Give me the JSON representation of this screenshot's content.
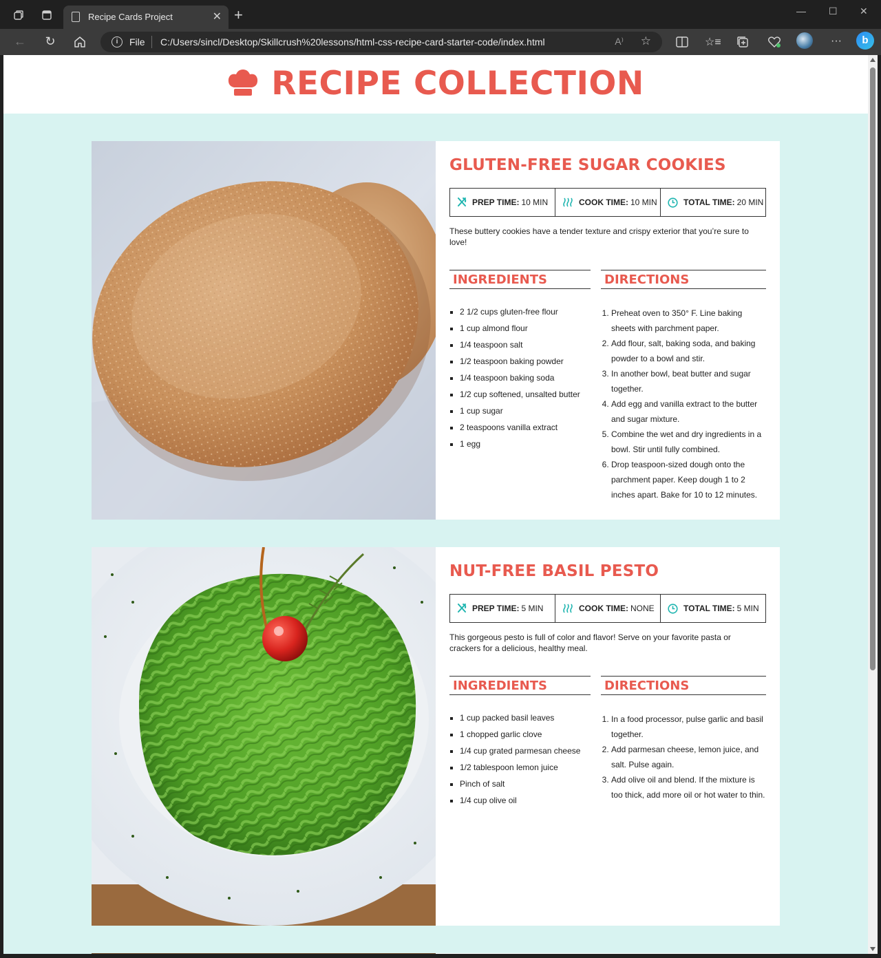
{
  "browser": {
    "tab_title": "Recipe Cards Project",
    "address_scheme": "File",
    "address_url": "C:/Users/sincl/Desktop/Skillcrush%20lessons/html-css-recipe-card-starter-code/index.html",
    "read_aloud_label": "A⁾",
    "bing_label": "b"
  },
  "page": {
    "title": "RECIPE COLLECTION",
    "accent_color": "#e85a4f",
    "icon_color": "#1fb5b0",
    "background_color": "#d8f3f1"
  },
  "recipes": [
    {
      "title": "GLUTEN-FREE SUGAR COOKIES",
      "prep_label": "PREP TIME:",
      "prep_value": "10 MIN",
      "cook_label": "COOK TIME:",
      "cook_value": "10 MIN",
      "total_label": "TOTAL TIME:",
      "total_value": "20 MIN",
      "description": "These buttery cookies have a tender texture and crispy exterior that you’re sure to love!",
      "ingredients_heading": "INGREDIENTS",
      "directions_heading": "DIRECTIONS",
      "ingredients": [
        "2 1/2 cups gluten-free flour",
        "1 cup almond flour",
        "1/4 teaspoon salt",
        "1/2 teaspoon baking powder",
        "1/4 teaspoon baking soda",
        "1/2 cup softened, unsalted butter",
        "1 cup sugar",
        "2 teaspoons vanilla extract",
        "1 egg"
      ],
      "directions": [
        "Preheat oven to 350° F. Line baking sheets with parchment paper.",
        "Add flour, salt, baking soda, and baking powder to a bowl and stir.",
        "In another bowl, beat butter and sugar together.",
        "Add egg and vanilla extract to the butter and sugar mixture.",
        "Combine the wet and dry ingredients in a bowl. Stir until fully combined.",
        "Drop teaspoon-sized dough onto the parchment paper. Keep dough 1 to 2 inches apart. Bake for 10 to 12 minutes."
      ]
    },
    {
      "title": "NUT-FREE BASIL PESTO",
      "prep_label": "PREP TIME:",
      "prep_value": "5 MIN",
      "cook_label": "COOK TIME:",
      "cook_value": "NONE",
      "total_label": "TOTAL TIME:",
      "total_value": "5 MIN",
      "description": "This gorgeous pesto is full of color and flavor! Serve on your favorite pasta or crackers for a delicious, healthy meal.",
      "ingredients_heading": "INGREDIENTS",
      "directions_heading": "DIRECTIONS",
      "ingredients": [
        "1 cup packed basil leaves",
        "1 chopped garlic clove",
        "1/4 cup grated parmesan cheese",
        "1/2 tablespoon lemon juice",
        "Pinch of salt",
        "1/4 cup olive oil"
      ],
      "directions": [
        "In a food processor, pulse garlic and basil together.",
        "Add parmesan cheese, lemon juice, and salt. Pulse again.",
        "Add olive oil and blend. If the mixture is too thick, add more oil or hot water to thin."
      ]
    }
  ]
}
